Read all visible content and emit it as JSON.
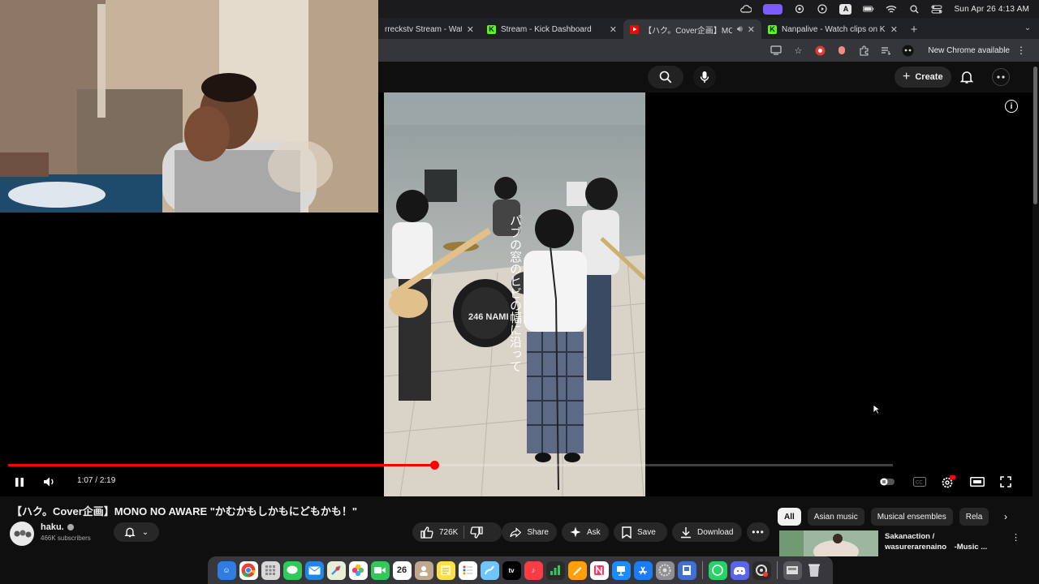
{
  "menubar": {
    "datetime": "Sun Apr 26  4:13 AM",
    "input_letter": "A",
    "icons": [
      "cloud-sync-icon",
      "screen-mirror-icon",
      "chatgpt-icon",
      "play-circle-icon",
      "keyboard-input-icon",
      "battery-icon",
      "wifi-icon",
      "spotlight-search-icon",
      "control-center-icon"
    ]
  },
  "browser": {
    "tabs": [
      {
        "title": "rreckstv Stream - Watch",
        "favicon": "kick-icon",
        "active": false
      },
      {
        "title": "Stream - Kick Dashboard",
        "favicon": "kick-icon",
        "active": false
      },
      {
        "title": "【ハク。Cover企画】MONO",
        "favicon": "youtube-icon",
        "active": true,
        "audio": true
      },
      {
        "title": "Nanpalive - Watch clips on Ki",
        "favicon": "kick-icon",
        "active": false
      }
    ],
    "new_chrome_label": "New Chrome available",
    "colors": {
      "kick": "#53fc18",
      "youtube": "#ff0000"
    }
  },
  "youtube": {
    "create_label": "Create",
    "video": {
      "title": "【ハク。Cover企画】MONO NO AWARE \"かむかもしかもにどもかも！\"",
      "current_time": "1:07",
      "duration": "2:19",
      "time_separator": "/",
      "progress": 0.482,
      "lyric_overlay": "パブの窓のヒビの幅に沿って",
      "drum_logo": "246 NAMI"
    },
    "channel": {
      "name": "haku.",
      "subscribers": "466K subscribers"
    },
    "actions": {
      "likes": "726K",
      "share": "Share",
      "ask": "Ask",
      "save": "Save",
      "download": "Download"
    },
    "chips": [
      "All",
      "Asian music",
      "Musical ensembles",
      "Rela"
    ],
    "recommendation": {
      "title_line1": "Sakanaction /",
      "title_line2": "wasurerarenaino　-Music ..."
    }
  }
}
